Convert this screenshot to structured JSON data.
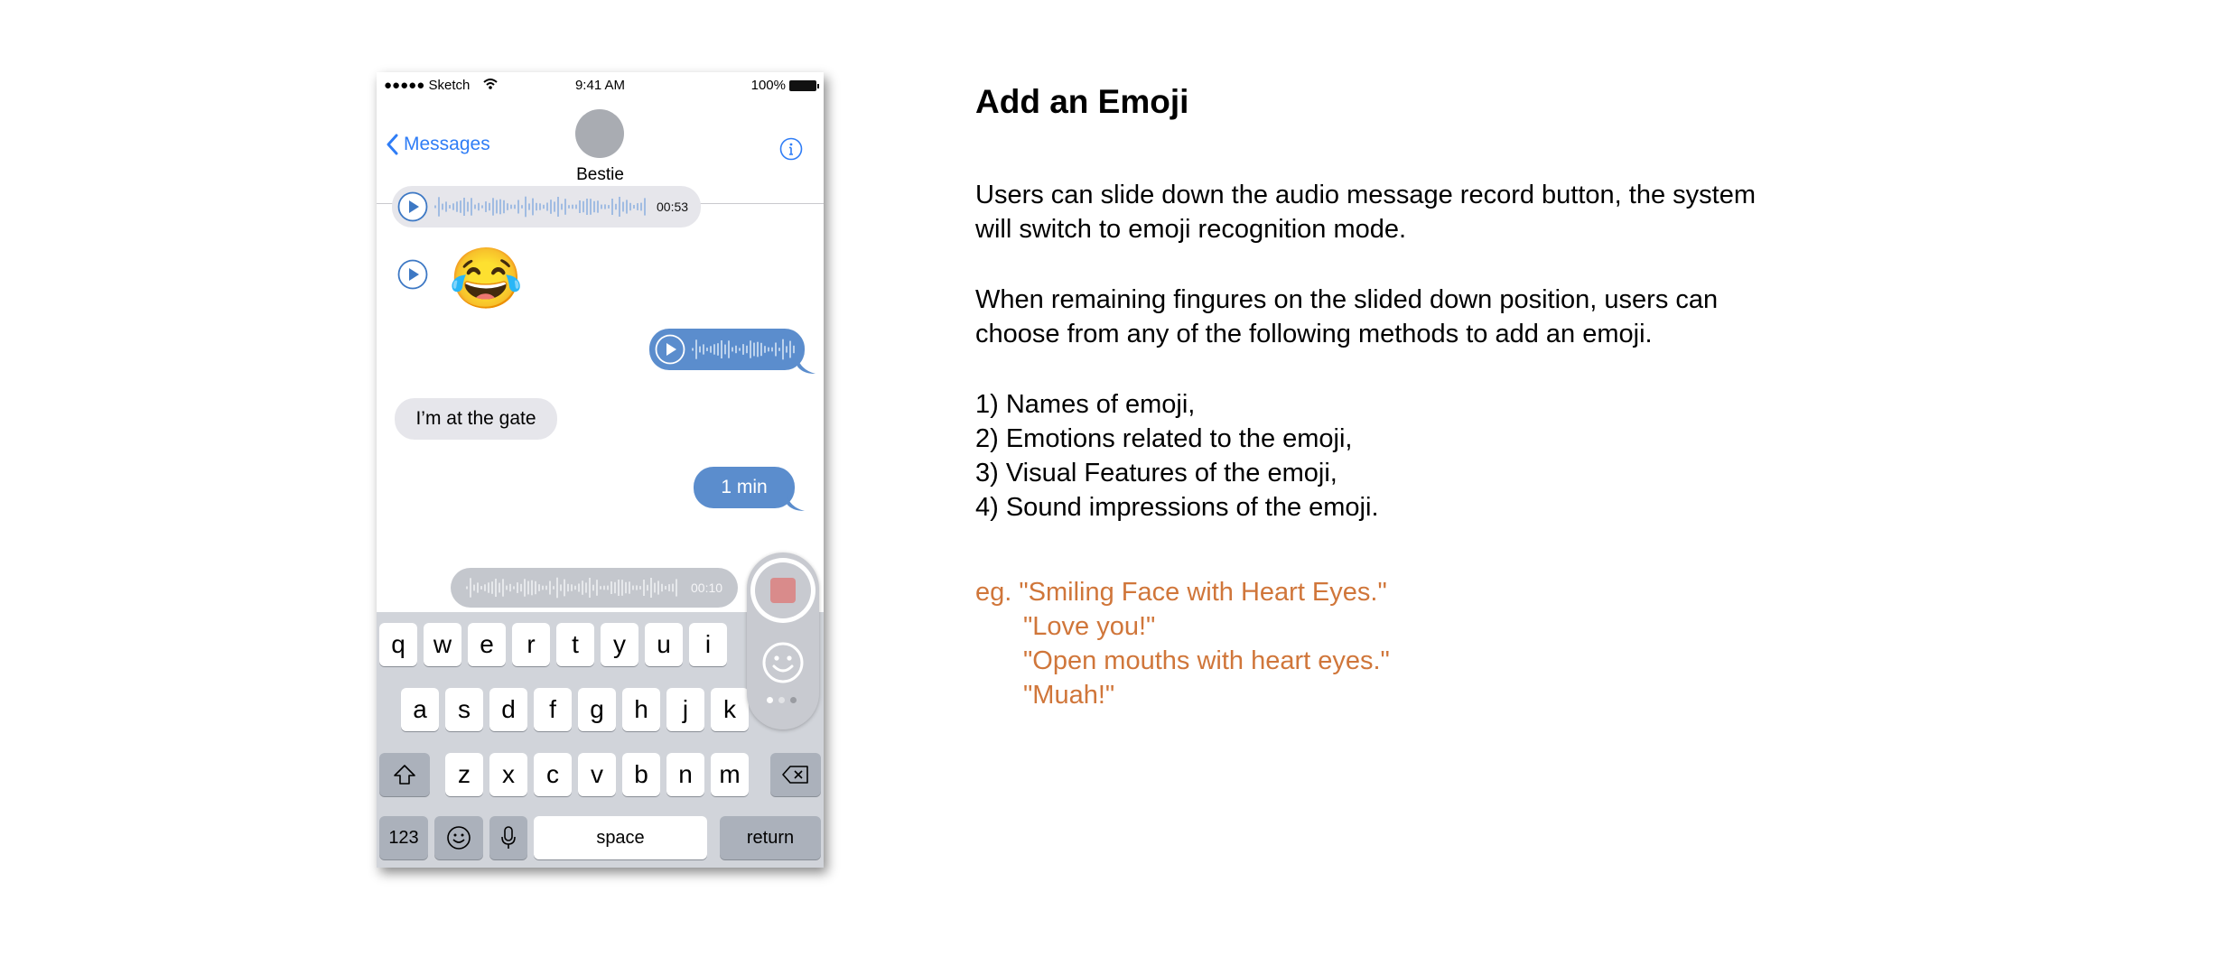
{
  "phone": {
    "status": {
      "carrier": "●●●●● Sketch",
      "time": "9:41 AM",
      "battery": "100%"
    },
    "nav": {
      "back_label": "Messages",
      "contact_name": "Bestie",
      "info_icon": "info-icon"
    },
    "messages": [
      {
        "type": "audio",
        "direction": "incoming",
        "duration": "00:53"
      },
      {
        "type": "emoji",
        "direction": "incoming",
        "emoji": "😂"
      },
      {
        "type": "audio",
        "direction": "outgoing"
      },
      {
        "type": "text",
        "direction": "incoming",
        "text": "I’m at the gate"
      },
      {
        "type": "text",
        "direction": "outgoing",
        "text": "1 min"
      }
    ],
    "recording": {
      "duration": "00:10"
    },
    "keyboard": {
      "row1": [
        "q",
        "w",
        "e",
        "r",
        "t",
        "y",
        "u",
        "i"
      ],
      "row2": [
        "a",
        "s",
        "d",
        "f",
        "g",
        "h",
        "j",
        "k"
      ],
      "row3": [
        "z",
        "x",
        "c",
        "v",
        "b",
        "n",
        "m"
      ],
      "numbers_label": "123",
      "space_label": "space",
      "return_label": "return"
    },
    "colors": {
      "accent": "#2f7df6",
      "outgoing_bubble": "#5b8dcd",
      "incoming_bubble": "#e6e6eb",
      "record": "#d98b8b"
    }
  },
  "doc": {
    "title": "Add an Emoji",
    "para1": [
      "Users can slide down the audio message record button, the system",
      "will switch to emoji recognition mode."
    ],
    "para2": [
      "When remaining fingures on the slided down position, users can",
      "choose from any of the following methods to add an emoji."
    ],
    "list": [
      "1) Names of emoji,",
      "2) Emotions related to the emoji,",
      "3) Visual Features of the emoji,",
      "4) Sound impressions of the emoji."
    ],
    "examples": [
      "eg. \"Smiling Face with Heart Eyes.\"",
      "\"Love you!\"",
      "\"Open mouths with heart eyes.\"",
      "\"Muah!\""
    ]
  }
}
